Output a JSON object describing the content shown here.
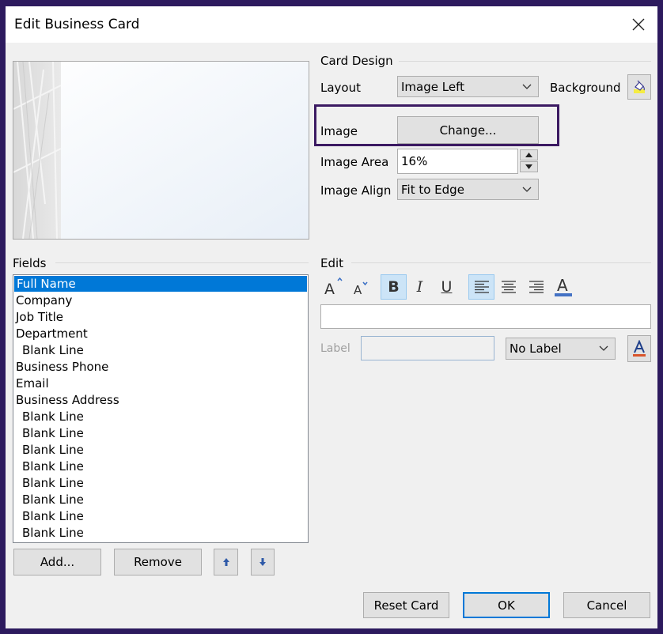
{
  "window": {
    "title": "Edit Business Card"
  },
  "card_design": {
    "header": "Card Design",
    "layout_label": "Layout",
    "layout_value": "Image Left",
    "background_label": "Background",
    "image_label": "Image",
    "change_button": "Change...",
    "image_area_label": "Image Area",
    "image_area_value": "16%",
    "image_align_label": "Image Align",
    "image_align_value": "Fit to Edge"
  },
  "fields": {
    "header": "Fields",
    "items": [
      {
        "label": "Full Name",
        "selected": true,
        "indent": false
      },
      {
        "label": "Company",
        "indent": false
      },
      {
        "label": "Job Title",
        "indent": false
      },
      {
        "label": "Department",
        "indent": false
      },
      {
        "label": "Blank Line",
        "indent": true
      },
      {
        "label": "Business Phone",
        "indent": false
      },
      {
        "label": "Email",
        "indent": false
      },
      {
        "label": "Business Address",
        "indent": false
      },
      {
        "label": "Blank Line",
        "indent": true
      },
      {
        "label": "Blank Line",
        "indent": true
      },
      {
        "label": "Blank Line",
        "indent": true
      },
      {
        "label": "Blank Line",
        "indent": true
      },
      {
        "label": "Blank Line",
        "indent": true
      },
      {
        "label": "Blank Line",
        "indent": true
      },
      {
        "label": "Blank Line",
        "indent": true
      },
      {
        "label": "Blank Line",
        "indent": true
      }
    ],
    "add_button": "Add...",
    "remove_button": "Remove"
  },
  "edit": {
    "header": "Edit",
    "text_value": "",
    "label_label": "Label",
    "label_value": "",
    "label_position": "No Label",
    "toolbar": {
      "grow_font_icon": "A",
      "shrink_font_icon": "A",
      "bold_icon": "B",
      "italic_icon": "I",
      "underline_icon": "U",
      "font_color_icon": "A"
    }
  },
  "footer": {
    "reset_button": "Reset Card",
    "ok_button": "OK",
    "cancel_button": "Cancel"
  },
  "colors": {
    "frame": "#2d1a5e",
    "highlight_border": "#3b1a62",
    "selection": "#0078d7",
    "font_color_bar": "#4472c4"
  }
}
